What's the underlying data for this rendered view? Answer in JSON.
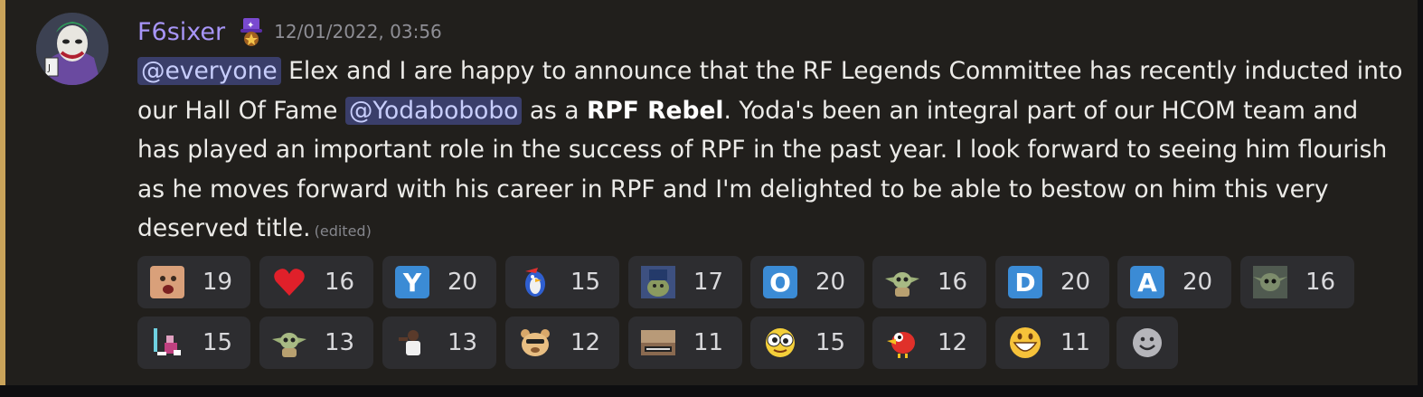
{
  "message": {
    "username": "F6sixer",
    "timestamp": "12/01/2022, 03:56",
    "content_parts": {
      "mention_everyone": "@everyone",
      "text1": " Elex and I are happy to announce that the RF Legends Committee has recently inducted into our Hall Of Fame ",
      "mention_user": "@Yodabobobo",
      "text2": " as a ",
      "bold": "RPF Rebel",
      "text3": ". Yoda's been an integral part of our HCOM team and has played an important role in the success of RPF in the past year. I look forward to seeing him flourish as he moves forward with his career in RPF and I'm delighted to be able to bestow on him this very deserved title.",
      "edited": "(edited)"
    }
  },
  "reactions": [
    {
      "emoji": "face-emoji",
      "count": "19"
    },
    {
      "emoji": "heart-emoji",
      "count": "16"
    },
    {
      "emoji": "letter-y-emoji",
      "letter": "Y",
      "count": "20"
    },
    {
      "emoji": "penguin-emoji",
      "count": "15"
    },
    {
      "emoji": "yoda-photo-emoji",
      "count": "17"
    },
    {
      "emoji": "letter-o-emoji",
      "letter": "O",
      "count": "20"
    },
    {
      "emoji": "baby-yoda-emoji",
      "count": "16"
    },
    {
      "emoji": "letter-d-emoji",
      "letter": "D",
      "count": "20"
    },
    {
      "emoji": "letter-a-emoji",
      "letter": "A",
      "count": "20"
    },
    {
      "emoji": "grogu-emoji",
      "count": "16"
    },
    {
      "emoji": "pixel-character-emoji",
      "count": "15"
    },
    {
      "emoji": "baby-yoda-emoji",
      "count": "13"
    },
    {
      "emoji": "person-emoji",
      "count": "13"
    },
    {
      "emoji": "bear-emoji",
      "count": "12"
    },
    {
      "emoji": "meme-photo-emoji",
      "count": "11"
    },
    {
      "emoji": "goofy-eyes-emoji",
      "count": "15"
    },
    {
      "emoji": "bird-emoji",
      "count": "12"
    },
    {
      "emoji": "grinning-face-emoji",
      "count": "11"
    }
  ],
  "colors": {
    "background": "#211f1c",
    "accent_bar": "#c9a35a",
    "username": "#a795f7",
    "mention_bg": "#3a3e6a",
    "reaction_bg": "#2d2d30"
  }
}
